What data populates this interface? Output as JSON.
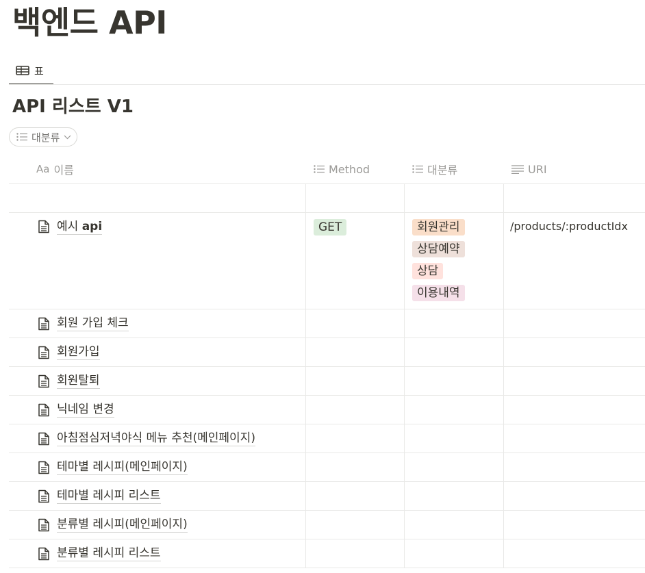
{
  "page": {
    "title": "백엔드 API"
  },
  "view_tab": {
    "label": "표"
  },
  "database": {
    "title": "API 리스트 V1"
  },
  "filter": {
    "label": "대분류"
  },
  "columns": {
    "name": "이름",
    "name_prefix": "Aa",
    "method": "Method",
    "category": "대분류",
    "uri": "URI"
  },
  "example_row": {
    "name_plain": "예시 ",
    "name_bold": "api",
    "method": "GET",
    "tags": [
      "회원관리",
      "상담예약",
      "상담",
      "이용내역"
    ],
    "uri": "/products/:productIdx"
  },
  "rows": [
    "회원 가입 체크",
    "회원가입",
    "회원탈퇴",
    "닉네임 변경",
    "아침점심저녁야식 메뉴 추천(메인페이지)",
    "테마별 레시피(메인페이지)",
    "테마별 레시피 리스트",
    "분류별 레시피(메인페이지)",
    "분류별 레시피 리스트"
  ],
  "colors": {
    "tag_green": "#dbeddb",
    "tag_orange": "#fadec9",
    "tag_brown": "#eee0da",
    "tag_red": "#ffe2dd",
    "tag_pink": "#f5e0e9"
  }
}
